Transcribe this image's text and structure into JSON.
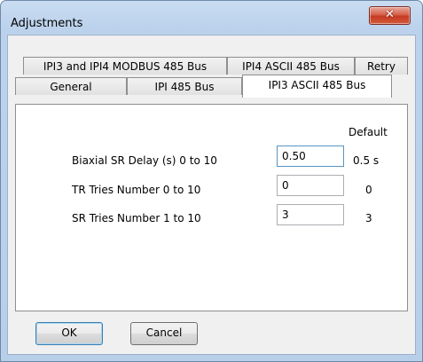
{
  "window": {
    "title": "Adjustments",
    "close_glyph": "✕"
  },
  "tabs": {
    "row1": [
      {
        "label": "IPI3 and IPI4 MODBUS 485 Bus"
      },
      {
        "label": "IPI4 ASCII 485 Bus"
      },
      {
        "label": "Retry"
      }
    ],
    "row2": [
      {
        "label": "General"
      },
      {
        "label": "IPI 485 Bus"
      },
      {
        "label": "IPI3 ASCII 485 Bus",
        "active": true
      }
    ]
  },
  "panel": {
    "default_header": "Default",
    "rows": [
      {
        "label": "Biaxial SR Delay (s)  0 to 10",
        "value": "0.50",
        "default": "0.5 s"
      },
      {
        "label": "TR Tries Number  0 to 10",
        "value": "0",
        "default": "0"
      },
      {
        "label": "SR Tries Number  1 to 10",
        "value": "3",
        "default": "3"
      }
    ]
  },
  "buttons": {
    "ok": "OK",
    "cancel": "Cancel"
  },
  "colors": {
    "title_bar": "#c9dcf1",
    "close_button": "#c53a22",
    "dialog_bg": "#f0f0f0",
    "focus_border": "#5794bf"
  }
}
